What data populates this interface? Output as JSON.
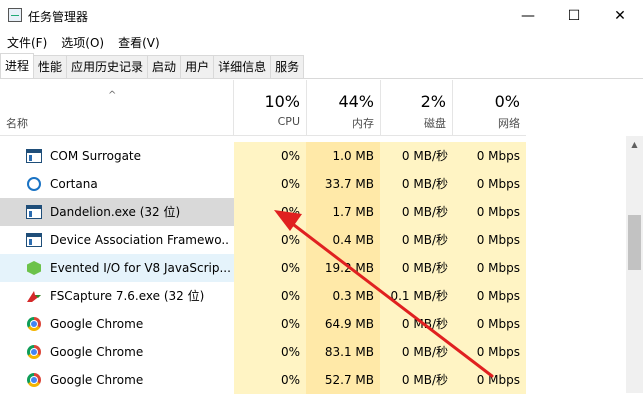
{
  "window": {
    "title": "任务管理器",
    "minimize_glyph": "—",
    "maximize_glyph": "☐",
    "close_glyph": "✕"
  },
  "menu": [
    {
      "label": "文件(F)"
    },
    {
      "label": "选项(O)"
    },
    {
      "label": "查看(V)"
    }
  ],
  "tabs": [
    {
      "label": "进程",
      "active": true
    },
    {
      "label": "性能"
    },
    {
      "label": "应用历史记录"
    },
    {
      "label": "启动"
    },
    {
      "label": "用户"
    },
    {
      "label": "详细信息"
    },
    {
      "label": "服务"
    }
  ],
  "columns": {
    "sort_arrow": "^",
    "name": "名称",
    "cpu": {
      "percent": "10%",
      "label": "CPU"
    },
    "memory": {
      "percent": "44%",
      "label": "内存"
    },
    "disk": {
      "percent": "2%",
      "label": "磁盘"
    },
    "network": {
      "percent": "0%",
      "label": "网络"
    }
  },
  "processes": [
    {
      "name": "COM Surrogate",
      "icon": "window-icon",
      "cpu": "0%",
      "memory": "1.0 MB",
      "disk": "0 MB/秒",
      "network": "0 Mbps"
    },
    {
      "name": "Cortana",
      "icon": "cortana-icon",
      "cpu": "0%",
      "memory": "33.7 MB",
      "disk": "0 MB/秒",
      "network": "0 Mbps"
    },
    {
      "name": "Dandelion.exe (32 位)",
      "icon": "window-icon",
      "cpu": "0%",
      "memory": "1.7 MB",
      "disk": "0 MB/秒",
      "network": "0 Mbps",
      "state": "selected"
    },
    {
      "name": "Device Association Framewo...",
      "icon": "window-icon",
      "cpu": "0%",
      "memory": "0.4 MB",
      "disk": "0 MB/秒",
      "network": "0 Mbps"
    },
    {
      "name": "Evented I/O for V8 JavaScrip...",
      "icon": "nodejs-icon",
      "cpu": "0%",
      "memory": "19.2 MB",
      "disk": "0 MB/秒",
      "network": "0 Mbps",
      "state": "hover"
    },
    {
      "name": "FSCapture 7.6.exe (32 位)",
      "icon": "fscapture-icon",
      "cpu": "0%",
      "memory": "0.3 MB",
      "disk": "0.1 MB/秒",
      "network": "0 Mbps"
    },
    {
      "name": "Google Chrome",
      "icon": "chrome-icon",
      "cpu": "0%",
      "memory": "64.9 MB",
      "disk": "0 MB/秒",
      "network": "0 Mbps"
    },
    {
      "name": "Google Chrome",
      "icon": "chrome-icon",
      "cpu": "0%",
      "memory": "83.1 MB",
      "disk": "0 MB/秒",
      "network": "0 Mbps"
    },
    {
      "name": "Google Chrome",
      "icon": "chrome-icon",
      "cpu": "0%",
      "memory": "52.7 MB",
      "disk": "0 MB/秒",
      "network": "0 Mbps"
    }
  ],
  "colors": {
    "heat_light": "#fff4c4",
    "heat_medium": "#ffe9a8",
    "selected_row": "#d9d9d9",
    "hover_row": "#e5f3fb",
    "annotation_arrow": "#e02020"
  }
}
